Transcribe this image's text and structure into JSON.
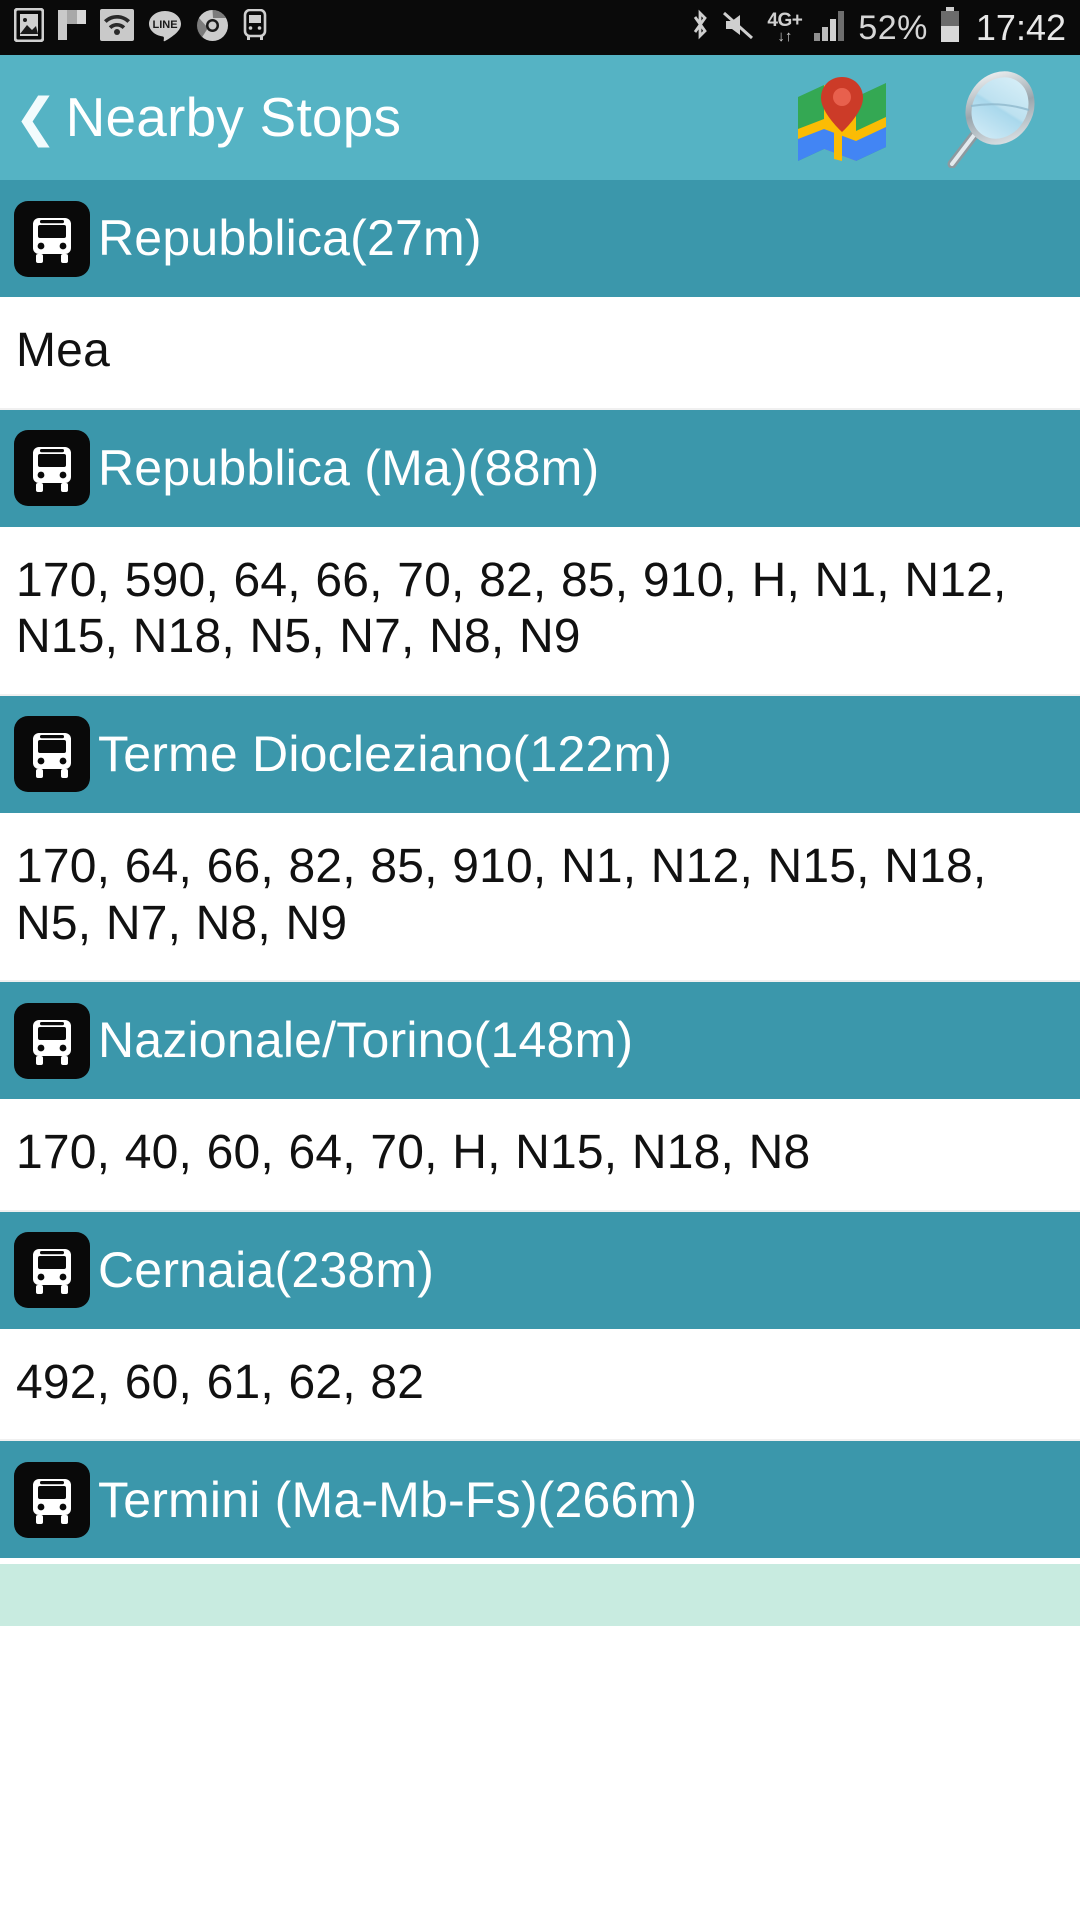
{
  "statusbar": {
    "left_icons": [
      "gallery-icon",
      "flipboard-icon",
      "wifi-icon",
      "line-app-icon",
      "chrome-icon",
      "bus-app-icon"
    ],
    "right_icons": [
      "bluetooth-icon",
      "mute-icon",
      "data-transfer-icon",
      "signal-bars-icon",
      "battery-icon"
    ],
    "network_label": "4G+",
    "network_arrows": "↓↑",
    "battery_percent": "52%",
    "time": "17:42"
  },
  "appbar": {
    "back_chevron": "❮",
    "title": "Nearby Stops",
    "map_icon": "map-icon",
    "search_icon": "magnifier-icon",
    "background_color": "#55b3c4"
  },
  "colors": {
    "header_teal": "#55b3c4",
    "row_teal": "#3b97ab",
    "footer_mint": "#c8ebe0",
    "badge_black": "#090909"
  },
  "stops": [
    {
      "name": "Repubblica(27m)",
      "icon": "bus-icon",
      "routes": "Mea"
    },
    {
      "name": "Repubblica (Ma)(88m)",
      "icon": "bus-icon",
      "routes": "170, 590, 64, 66, 70, 82, 85, 910, H, N1, N12, N15, N18, N5, N7, N8, N9"
    },
    {
      "name": "Terme Diocleziano(122m)",
      "icon": "bus-icon",
      "routes": "170, 64, 66, 82, 85, 910, N1, N12, N15, N18, N5, N7, N8, N9"
    },
    {
      "name": "Nazionale/Torino(148m)",
      "icon": "bus-icon",
      "routes": "170, 40, 60, 64, 70, H, N15, N18, N8"
    },
    {
      "name": "Cernaia(238m)",
      "icon": "bus-icon",
      "routes": "492, 60, 61, 62, 82"
    },
    {
      "name": "Termini (Ma-Mb-Fs)(266m)",
      "icon": "bus-icon",
      "routes": ""
    }
  ]
}
